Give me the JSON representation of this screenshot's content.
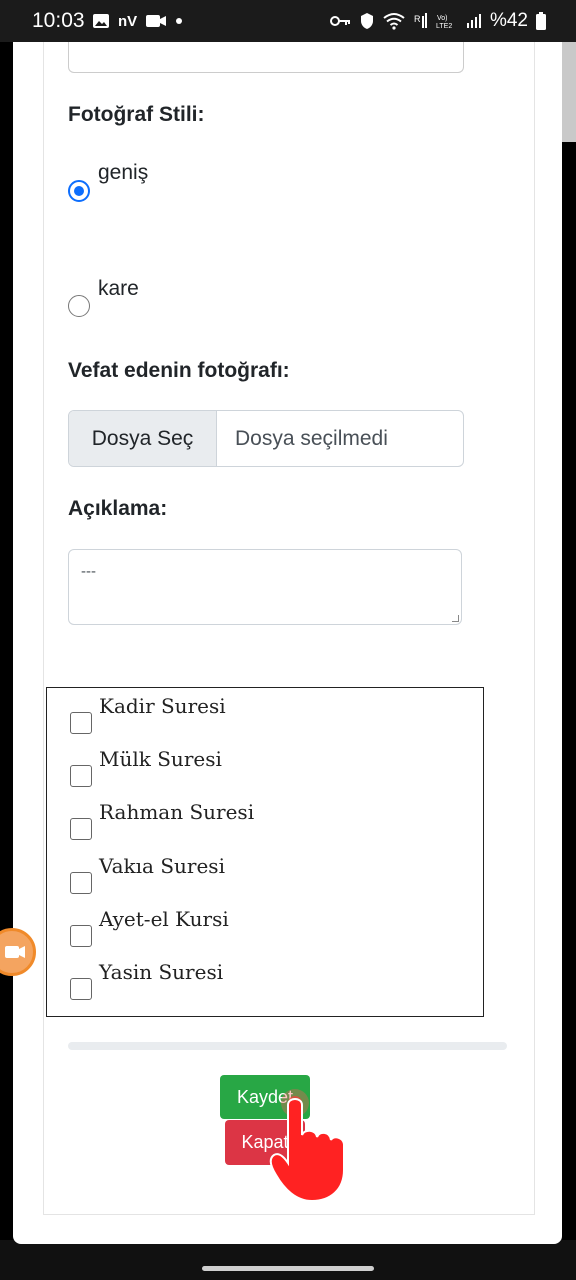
{
  "status_bar": {
    "time": "10:03",
    "carrier_label": "nV",
    "battery_text": "%42"
  },
  "form": {
    "photo_style_label": "Fotoğraf Stili:",
    "photo_style_options": [
      {
        "label": "geniş",
        "checked": true
      },
      {
        "label": "kare",
        "checked": false
      }
    ],
    "photo_label": "Vefat edenin fotoğrafı:",
    "file_button": "Dosya Seç",
    "file_status": "Dosya seçilmedi",
    "description_label": "Açıklama:",
    "description_value": "---",
    "surahs": [
      {
        "label": "Kadir Suresi",
        "checked": false
      },
      {
        "label": "Mülk Suresi",
        "checked": false
      },
      {
        "label": "Rahman Suresi",
        "checked": false
      },
      {
        "label": "Vakıa Suresi",
        "checked": false
      },
      {
        "label": "Ayet-el Kursi",
        "checked": false
      },
      {
        "label": "Yasin Suresi",
        "checked": false
      }
    ],
    "save_label": "Kaydet",
    "close_label": "Kapat"
  },
  "colors": {
    "save": "#28a745",
    "close": "#dc3545",
    "radio_accent": "#0d6efd"
  }
}
